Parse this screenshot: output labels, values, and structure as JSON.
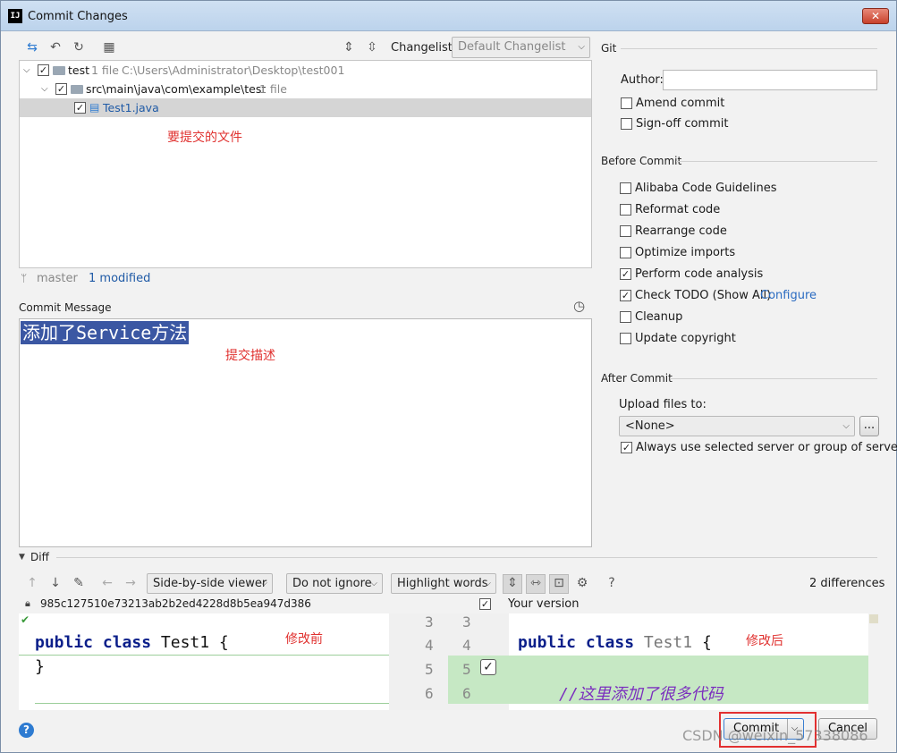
{
  "window": {
    "title": "Commit Changes",
    "app_icon": "IJ",
    "close": "✕"
  },
  "toolbar": {
    "changelist_label": "Changelist:",
    "changelist_value": "Default Changelist"
  },
  "tree": {
    "root": {
      "name": "test",
      "count": "1 file",
      "path": "C:\\Users\\Administrator\\Desktop\\test001"
    },
    "folder": {
      "name": "src\\main\\java\\com\\example\\test",
      "count": "1 file"
    },
    "file": {
      "name": "Test1.java"
    }
  },
  "notes": {
    "files": "要提交的文件",
    "message": "提交描述",
    "before": "修改前",
    "after": "修改后"
  },
  "status": {
    "branch": "master",
    "modified": "1 modified"
  },
  "commit_message": {
    "label": "Commit Message",
    "text": "添加了Service方法"
  },
  "git": {
    "header": "Git",
    "author_label": "Author:",
    "author_value": "",
    "amend": "Amend commit",
    "signoff": "Sign-off commit"
  },
  "before_commit": {
    "header": "Before Commit",
    "options": [
      {
        "label": "Alibaba Code Guidelines",
        "checked": false
      },
      {
        "label": "Reformat code",
        "checked": false
      },
      {
        "label": "Rearrange code",
        "checked": false
      },
      {
        "label": "Optimize imports",
        "checked": false
      },
      {
        "label": "Perform code analysis",
        "checked": true
      },
      {
        "label": "Check TODO (Show All)",
        "checked": true
      },
      {
        "label": "Cleanup",
        "checked": false
      },
      {
        "label": "Update copyright",
        "checked": false
      }
    ],
    "configure_link": "Configure"
  },
  "after_commit": {
    "header": "After Commit",
    "upload_label": "Upload files to:",
    "upload_value": "<None>",
    "browse": "...",
    "always_use": "Always use selected server or group of servers"
  },
  "diff": {
    "header": "Diff",
    "viewer": "Side-by-side viewer",
    "ignore": "Do not ignore",
    "highlight": "Highlight words",
    "count": "2 differences",
    "left_hash": "985c127510e73213ab2b2ed4228d8b5ea947d386",
    "right_label": "Your version",
    "left_line1": {
      "kw1": "public",
      "kw2": "class",
      "rest": "Test1 {"
    },
    "left_line2": "}",
    "right_line1": {
      "kw1": "public",
      "kw2": "class",
      "name": "Test1",
      "brace": "{"
    },
    "right_comment": "//这里添加了很多代码",
    "line_numbers_left": [
      "3",
      "4",
      "5",
      "6"
    ],
    "line_numbers_right": [
      "3",
      "4",
      "5",
      "6"
    ]
  },
  "buttons": {
    "commit": "Commit",
    "cancel": "Cancel",
    "help": "?"
  },
  "watermark": "CSDN @weixin_57338086"
}
